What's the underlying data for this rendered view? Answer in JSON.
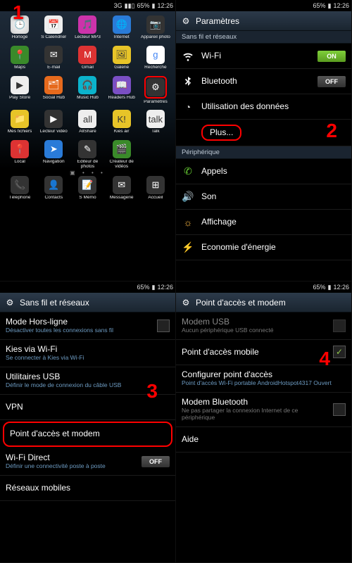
{
  "status": {
    "time": "12:26",
    "battery": "65%",
    "signal": "3G"
  },
  "steps": {
    "s1": "1",
    "s2": "2",
    "s3": "3",
    "s4": "4"
  },
  "panel1": {
    "apps": [
      {
        "label": "Horloge",
        "glyph": "🕒"
      },
      {
        "label": "S Calendrier",
        "glyph": "📅"
      },
      {
        "label": "Lecteur MP3",
        "glyph": "🎵"
      },
      {
        "label": "Internet",
        "glyph": "🌐"
      },
      {
        "label": "Appareil photo",
        "glyph": "📷"
      },
      {
        "label": "Maps",
        "glyph": "📍"
      },
      {
        "label": "E-mail",
        "glyph": "✉"
      },
      {
        "label": "Gmail",
        "glyph": "M"
      },
      {
        "label": "Galerie",
        "glyph": "🖼"
      },
      {
        "label": "Recherche",
        "glyph": "g"
      },
      {
        "label": "Play Store",
        "glyph": "▶"
      },
      {
        "label": "Social Hub",
        "glyph": "🗂"
      },
      {
        "label": "Music Hub",
        "glyph": "🎧"
      },
      {
        "label": "Readers Hub",
        "glyph": "📖"
      },
      {
        "label": "Paramètres",
        "glyph": "⚙",
        "highlight": true
      },
      {
        "label": "Mes fichiers",
        "glyph": "📁"
      },
      {
        "label": "Lecteur vidéo",
        "glyph": "▶"
      },
      {
        "label": "AllShare",
        "glyph": "all"
      },
      {
        "label": "Kies air",
        "glyph": "K!"
      },
      {
        "label": "Talk",
        "glyph": "talk"
      },
      {
        "label": "Local",
        "glyph": "📍"
      },
      {
        "label": "Navigation",
        "glyph": "➤"
      },
      {
        "label": "Editeur de photos",
        "glyph": "✎"
      },
      {
        "label": "Créateur de vidéos",
        "glyph": "🎬"
      },
      {
        "label": ""
      }
    ],
    "dots": "▣ • • •",
    "dock": [
      {
        "label": "Téléphone",
        "glyph": "📞"
      },
      {
        "label": "Contacts",
        "glyph": "👤"
      },
      {
        "label": "S Mémo",
        "glyph": "📝"
      },
      {
        "label": "Messagerie",
        "glyph": "✉"
      },
      {
        "label": "Accueil",
        "glyph": "⊞"
      }
    ]
  },
  "panel2": {
    "title": "Paramètres",
    "sections": {
      "net": "Sans fil et réseaux",
      "dev": "Périphérique"
    },
    "rows": {
      "wifi": {
        "label": "Wi-Fi",
        "state": "ON"
      },
      "bt": {
        "label": "Bluetooth",
        "state": "OFF"
      },
      "data": {
        "label": "Utilisation des données"
      },
      "plus": {
        "label": "Plus..."
      },
      "calls": {
        "label": "Appels"
      },
      "sound": {
        "label": "Son"
      },
      "display": {
        "label": "Affichage"
      },
      "power": {
        "label": "Economie d'énergie"
      }
    }
  },
  "panel3": {
    "title": "Sans fil et réseaux",
    "rows": {
      "airplane": {
        "label": "Mode Hors-ligne",
        "sub": "Désactiver toutes les connexions sans fil"
      },
      "kies": {
        "label": "Kies via Wi-Fi",
        "sub": "Se connecter à Kies via Wi-Fi"
      },
      "usb": {
        "label": "Utilitaires USB",
        "sub": "Définir le mode de connexion du câble USB"
      },
      "vpn": {
        "label": "VPN"
      },
      "hotspot": {
        "label": "Point d'accès et modem"
      },
      "wifidirect": {
        "label": "Wi-Fi Direct",
        "sub": "Définir une connectivité poste à poste",
        "state": "OFF"
      },
      "mobile": {
        "label": "Réseaux mobiles"
      }
    }
  },
  "panel4": {
    "title": "Point d'accès et modem",
    "rows": {
      "usb": {
        "label": "Modem USB",
        "sub": "Aucun périphérique USB connecté"
      },
      "ap": {
        "label": "Point d'accès mobile"
      },
      "conf": {
        "label": "Configurer point d'accès",
        "sub": "Point d'accès Wi-Fi portable AndroidHotspot4317 Ouvert"
      },
      "bt": {
        "label": "Modem Bluetooth",
        "sub": "Ne pas partager la connexion Internet de ce périphérique"
      },
      "help": {
        "label": "Aide"
      }
    }
  }
}
